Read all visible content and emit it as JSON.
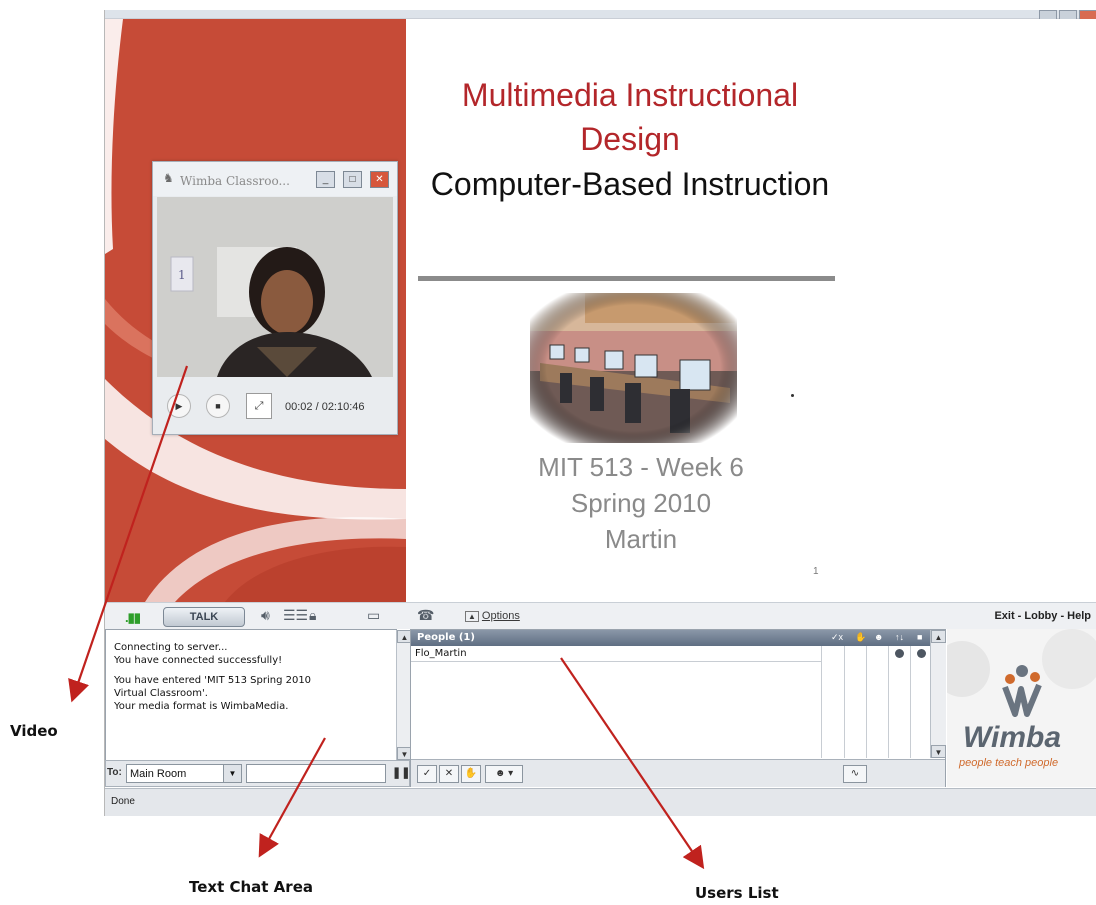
{
  "slide": {
    "title": "Multimedia Instructional Design",
    "subtitle": "Computer-Based Instruction",
    "course_lines": [
      "MIT 513 - Week 6",
      "Spring 2010",
      "Martin"
    ],
    "page_number": "1",
    "accent_color": "#b3262a"
  },
  "video_window": {
    "title": "Wimba Classroo...",
    "time": "00:02 / 02:10:46",
    "controls": [
      "play-icon",
      "stop-icon",
      "fullscreen-icon"
    ]
  },
  "toolbar": {
    "talk_label": "TALK",
    "options_label": "Options",
    "exit_lobby_help": "Exit - Lobby - Help"
  },
  "chat": {
    "messages": [
      "Connecting to server...",
      "You have connected successfully!",
      "You have entered 'MIT 513 Spring 2010",
      "Virtual Classroom'.",
      "Your media format is WimbaMedia."
    ],
    "to_label": "To:",
    "room_selected": "Main Room"
  },
  "people": {
    "header": "People (1)",
    "header_icons": [
      "✓x",
      "✋",
      "☻",
      "↑↓",
      "■"
    ],
    "users": [
      "Flo_Martin"
    ]
  },
  "brand": {
    "name": "Wimba",
    "tagline": "people teach people"
  },
  "status": {
    "text": "Done"
  },
  "annotations": {
    "video": "Video",
    "chat": "Text Chat Area",
    "users": "Users List"
  }
}
